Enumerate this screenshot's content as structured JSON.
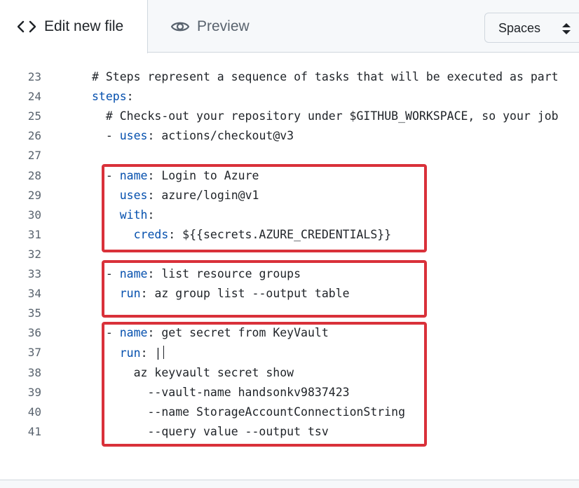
{
  "tabs": {
    "edit_label": "Edit new file",
    "preview_label": "Preview"
  },
  "indent_select": {
    "value": "Spaces"
  },
  "editor": {
    "lines": [
      {
        "n": "23",
        "indent": "",
        "kind": "comment",
        "text": "# Steps represent a sequence of tasks that will be executed as part"
      },
      {
        "n": "24",
        "indent": "",
        "kind": "keyonly",
        "key": "steps",
        "text": ":"
      },
      {
        "n": "25",
        "indent": "  ",
        "kind": "comment",
        "text": "# Checks-out your repository under $GITHUB_WORKSPACE, so your job"
      },
      {
        "n": "26",
        "indent": "  ",
        "kind": "item",
        "key": "uses",
        "val": "actions/checkout@v3"
      },
      {
        "n": "27",
        "indent": "",
        "kind": "blank"
      },
      {
        "n": "28",
        "indent": "  ",
        "kind": "item",
        "key": "name",
        "val": "Login to Azure"
      },
      {
        "n": "29",
        "indent": "    ",
        "kind": "kv",
        "key": "uses",
        "val": "azure/login@v1"
      },
      {
        "n": "30",
        "indent": "    ",
        "kind": "kv",
        "key": "with",
        "val": ""
      },
      {
        "n": "31",
        "indent": "      ",
        "kind": "kv",
        "key": "creds",
        "val": "${{secrets.AZURE_CREDENTIALS}}"
      },
      {
        "n": "32",
        "indent": "",
        "kind": "blank"
      },
      {
        "n": "33",
        "indent": "  ",
        "kind": "item",
        "key": "name",
        "val": "list resource groups"
      },
      {
        "n": "34",
        "indent": "    ",
        "kind": "kv",
        "key": "run",
        "val": "az group list --output table"
      },
      {
        "n": "35",
        "indent": "",
        "kind": "blank"
      },
      {
        "n": "36",
        "indent": "  ",
        "kind": "item",
        "key": "name",
        "val": "get secret from KeyVault"
      },
      {
        "n": "37",
        "indent": "    ",
        "kind": "kv",
        "key": "run",
        "val": "|",
        "cursor": true
      },
      {
        "n": "38",
        "indent": "      ",
        "kind": "plain",
        "text": "az keyvault secret show"
      },
      {
        "n": "39",
        "indent": "        ",
        "kind": "plain",
        "text": "--vault-name handsonkv9837423"
      },
      {
        "n": "40",
        "indent": "        ",
        "kind": "plain",
        "text": "--name StorageAccountConnectionString"
      },
      {
        "n": "41",
        "indent": "        ",
        "kind": "plain",
        "text": "--query value --output tsv"
      }
    ]
  },
  "colors": {
    "keyword": "#0550ae",
    "text": "#1f2328",
    "line_number": "#59636e",
    "highlight_border": "#d9313a",
    "tab_bar_bg": "#f6f8fa"
  }
}
